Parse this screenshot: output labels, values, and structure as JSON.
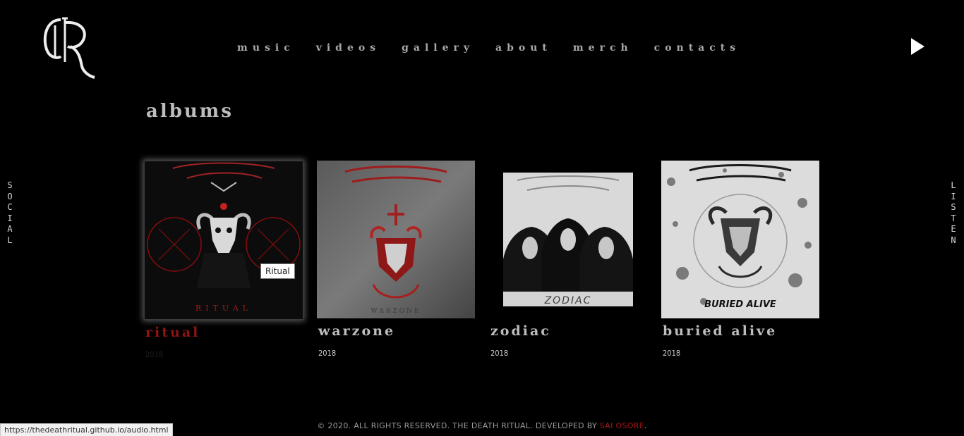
{
  "nav": {
    "items": [
      "music",
      "videos",
      "gallery",
      "about",
      "merch",
      "contacts"
    ]
  },
  "side": {
    "left_label": "SOCIAL",
    "right_label": "LISTEN"
  },
  "main": {
    "heading": "albums"
  },
  "albums": [
    {
      "title": "ritual",
      "year": "2018",
      "cover_text": "RITUAL"
    },
    {
      "title": "warzone",
      "year": "2018",
      "cover_text": "WARZONE"
    },
    {
      "title": "zodiac",
      "year": "2018",
      "cover_text": "ZODIAC"
    },
    {
      "title": "buried alive",
      "year": "2018",
      "cover_text": "BURIED ALIVE"
    }
  ],
  "tooltip": "Ritual",
  "footer": {
    "text": "© 2020. ALL RIGHTS RESERVED. THE DEATH RITUAL. DEVELOPED BY",
    "developer": "SAI OSORE",
    "end": "."
  },
  "statusbar": {
    "url": "https://thedeathritual.github.io/audio.html"
  },
  "colors": {
    "background": "#000000",
    "active_accent": "#8e1313",
    "developer_link": "#a61717"
  }
}
